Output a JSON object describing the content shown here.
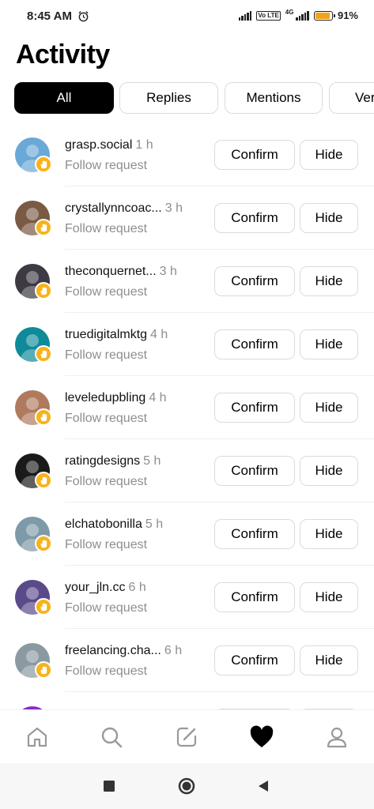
{
  "status_bar": {
    "time": "8:45 AM",
    "alarm_icon": "alarm-clock-icon",
    "volte": "Vo LTE",
    "network": "4G",
    "battery_percent": 91,
    "battery_label": "91%"
  },
  "header": {
    "title": "Activity"
  },
  "filters": [
    {
      "label": "All",
      "active": true
    },
    {
      "label": "Replies",
      "active": false
    },
    {
      "label": "Mentions",
      "active": false
    },
    {
      "label": "Ver",
      "active": false
    }
  ],
  "requests": [
    {
      "name": "grasp.social",
      "time": "1 h",
      "subtitle": "Follow request",
      "confirm": "Confirm",
      "hide": "Hide",
      "avatar_color": "#6aa8d8"
    },
    {
      "name": "crystallynncoac...",
      "time": "3 h",
      "subtitle": "Follow request",
      "confirm": "Confirm",
      "hide": "Hide",
      "avatar_color": "#7a5a44"
    },
    {
      "name": "theconquernet...",
      "time": "3 h",
      "subtitle": "Follow request",
      "confirm": "Confirm",
      "hide": "Hide",
      "avatar_color": "#3d3a44"
    },
    {
      "name": "truedigitalmktg",
      "time": "4 h",
      "subtitle": "Follow request",
      "confirm": "Confirm",
      "hide": "Hide",
      "avatar_color": "#0f8a9a"
    },
    {
      "name": "leveledupbling",
      "time": "4 h",
      "subtitle": "Follow request",
      "confirm": "Confirm",
      "hide": "Hide",
      "avatar_color": "#b07a5e"
    },
    {
      "name": "ratingdesigns",
      "time": "5 h",
      "subtitle": "Follow request",
      "confirm": "Confirm",
      "hide": "Hide",
      "avatar_color": "#1a1a1a"
    },
    {
      "name": "elchatobonilla",
      "time": "5 h",
      "subtitle": "Follow request",
      "confirm": "Confirm",
      "hide": "Hide",
      "avatar_color": "#7e9aa8"
    },
    {
      "name": "your_jln.cc",
      "time": "6 h",
      "subtitle": "Follow request",
      "confirm": "Confirm",
      "hide": "Hide",
      "avatar_color": "#5b4a8a"
    },
    {
      "name": "freelancing.cha...",
      "time": "6 h",
      "subtitle": "Follow request",
      "confirm": "Confirm",
      "hide": "Hide",
      "avatar_color": "#8a9aa0"
    }
  ],
  "colors": {
    "accent_badge": "#f8b21a",
    "muted_text": "#8e8e8e",
    "border": "#dbdbdb"
  },
  "bottom_nav": [
    {
      "icon": "home-icon"
    },
    {
      "icon": "search-icon"
    },
    {
      "icon": "compose-icon"
    },
    {
      "icon": "heart-icon",
      "active": true
    },
    {
      "icon": "profile-icon"
    }
  ],
  "system_nav": [
    {
      "icon": "recents-square-icon"
    },
    {
      "icon": "home-circle-icon"
    },
    {
      "icon": "back-triangle-icon"
    }
  ]
}
